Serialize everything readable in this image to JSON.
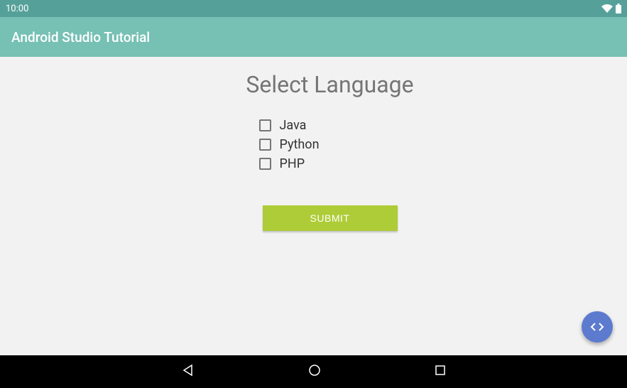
{
  "status": {
    "time": "10:00"
  },
  "appbar": {
    "title": "Android Studio Tutorial"
  },
  "main": {
    "heading": "Select Language",
    "checkboxes": [
      {
        "label": "Java"
      },
      {
        "label": "Python"
      },
      {
        "label": "PHP"
      }
    ],
    "submit_label": "SUBMIT"
  }
}
